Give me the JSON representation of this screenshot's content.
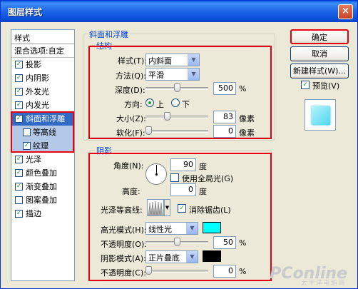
{
  "window": {
    "title": "图层样式",
    "close_glyph": "×"
  },
  "style_list": {
    "header": "样式",
    "blend_options": "混合选项:自定",
    "items": [
      {
        "label": "投影",
        "checked": true,
        "icon": "checkbox"
      },
      {
        "label": "内阴影",
        "checked": true
      },
      {
        "label": "外发光",
        "checked": true
      },
      {
        "label": "内发光",
        "checked": true
      },
      {
        "label": "斜面和浮雕",
        "checked": true,
        "selected": true
      },
      {
        "label": "等高线",
        "checked": false,
        "sub": true
      },
      {
        "label": "纹理",
        "checked": true,
        "sub": true
      },
      {
        "label": "光泽",
        "checked": true
      },
      {
        "label": "颜色叠加",
        "checked": true
      },
      {
        "label": "渐变叠加",
        "checked": true
      },
      {
        "label": "图案叠加",
        "checked": false
      },
      {
        "label": "描边",
        "checked": true
      }
    ]
  },
  "bevel": {
    "section_title": "斜面和浮雕",
    "structure_title": "结构",
    "style_label": "样式(T):",
    "style_value": "内斜面",
    "technique_label": "方法(Q):",
    "technique_value": "平滑",
    "depth_label": "深度(D):",
    "depth_value": "500",
    "depth_unit": "%",
    "depth_level": 0.5,
    "direction_label": "方向:",
    "direction_up": "上",
    "direction_down": "下",
    "size_label": "大小(Z):",
    "size_value": "83",
    "size_unit": "像素",
    "size_level": 0.33,
    "soften_label": "软化(F):",
    "soften_value": "0",
    "soften_unit": "像素",
    "soften_level": 0
  },
  "shading": {
    "title": "阴影",
    "angle_label": "角度(N):",
    "angle_value": "90",
    "angle_unit": "度",
    "global_light_label": "使用全局光(G)",
    "altitude_label": "高度:",
    "altitude_value": "0",
    "altitude_unit": "度",
    "gloss_label": "光泽等高线:",
    "antialias_label": "消除锯齿(L)",
    "highlight_mode_label": "高光模式(H):",
    "highlight_mode_value": "线性光",
    "highlight_color": "#00ffff",
    "highlight_opacity_label": "不透明度(O):",
    "highlight_opacity_value": "50",
    "highlight_opacity_unit": "%",
    "highlight_opacity_level": 0.5,
    "shadow_mode_label": "阴影模式(A):",
    "shadow_mode_value": "正片叠底",
    "shadow_color": "#000000",
    "shadow_opacity_label": "不透明度(C):",
    "shadow_opacity_value": "0",
    "shadow_opacity_unit": "%",
    "shadow_opacity_level": 0
  },
  "buttons": {
    "ok": "确定",
    "cancel": "取消",
    "new_style": "新建样式(W)...",
    "preview_label": "预览(V)"
  },
  "watermark": {
    "brand": "PConline",
    "sub": "太 平 洋 电 脑 网"
  },
  "colors": {
    "accent": "#316ac5",
    "highlight_box": "#e60012",
    "group_title": "#0046d5"
  }
}
